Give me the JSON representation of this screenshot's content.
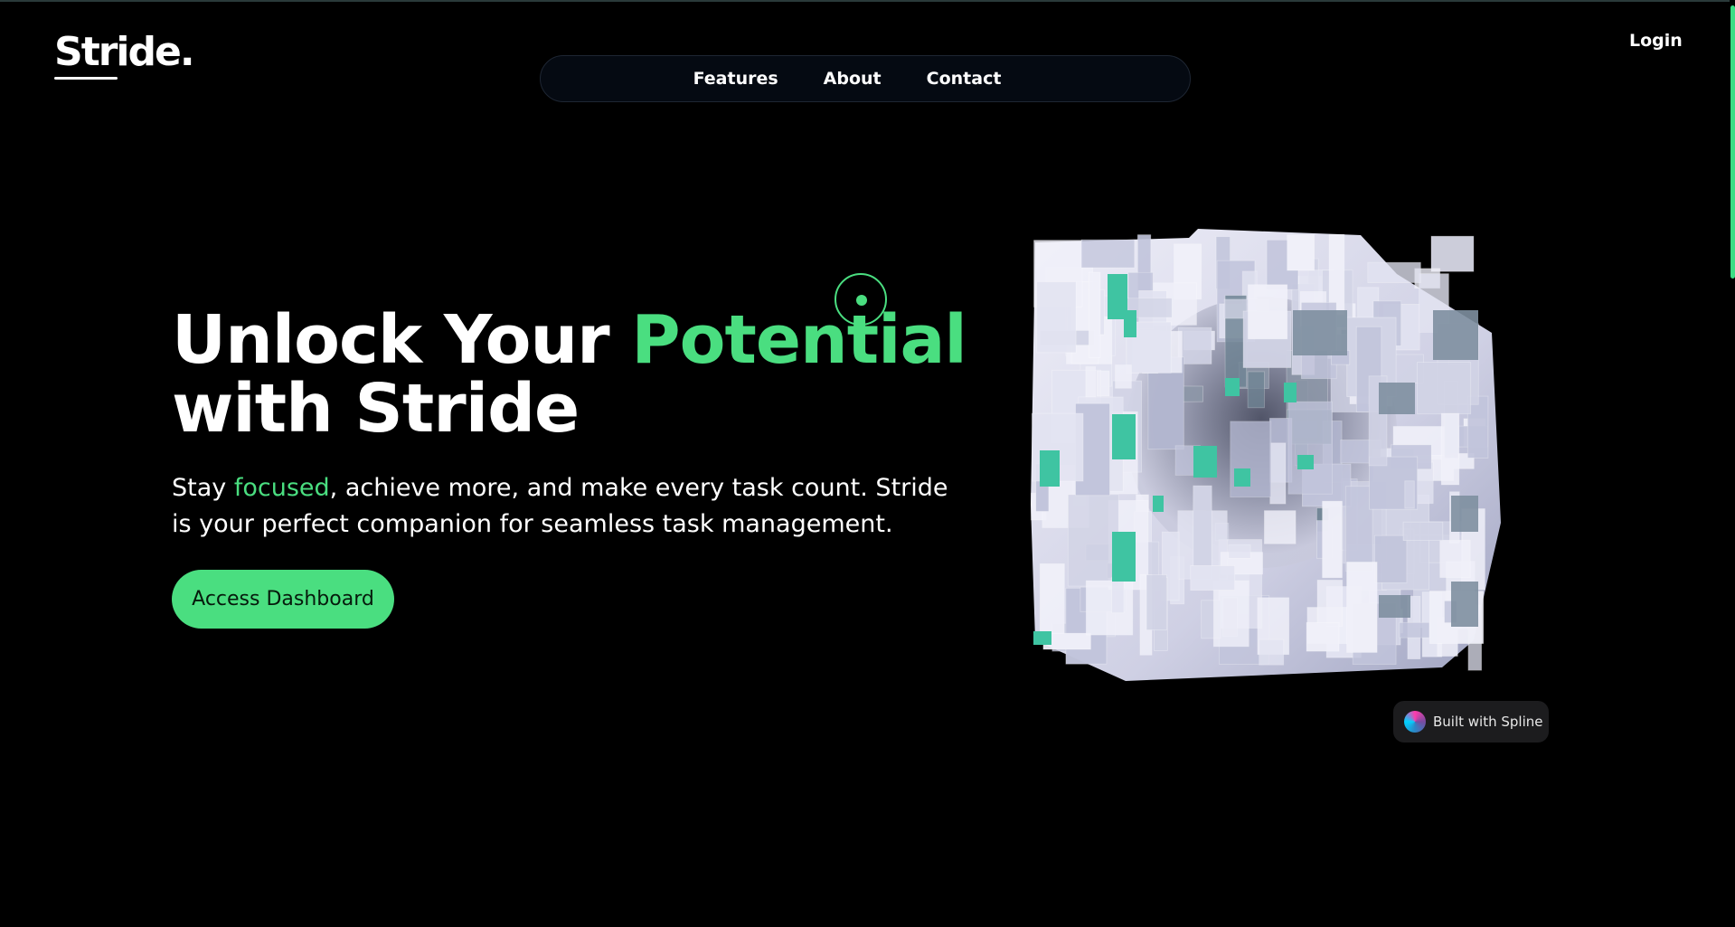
{
  "brand": {
    "logo_text": "Stride."
  },
  "nav": {
    "items": [
      "Features",
      "About",
      "Contact"
    ]
  },
  "header": {
    "login_label": "Login"
  },
  "hero": {
    "headline_part1": "Unlock Your ",
    "headline_accent": "Potential",
    "headline_part2": "with Stride",
    "subtitle_part1": "Stay ",
    "subtitle_accent": "focused",
    "subtitle_part2": ", achieve more, and make every task count. Stride is your perfect companion for seamless task management.",
    "cta_label": "Access Dashboard"
  },
  "visual": {
    "badge_text": "Built with Spline",
    "icon": "spline-icon"
  },
  "colors": {
    "accent": "#4ade80",
    "background": "#000000",
    "nav_bg": "#050a12"
  }
}
